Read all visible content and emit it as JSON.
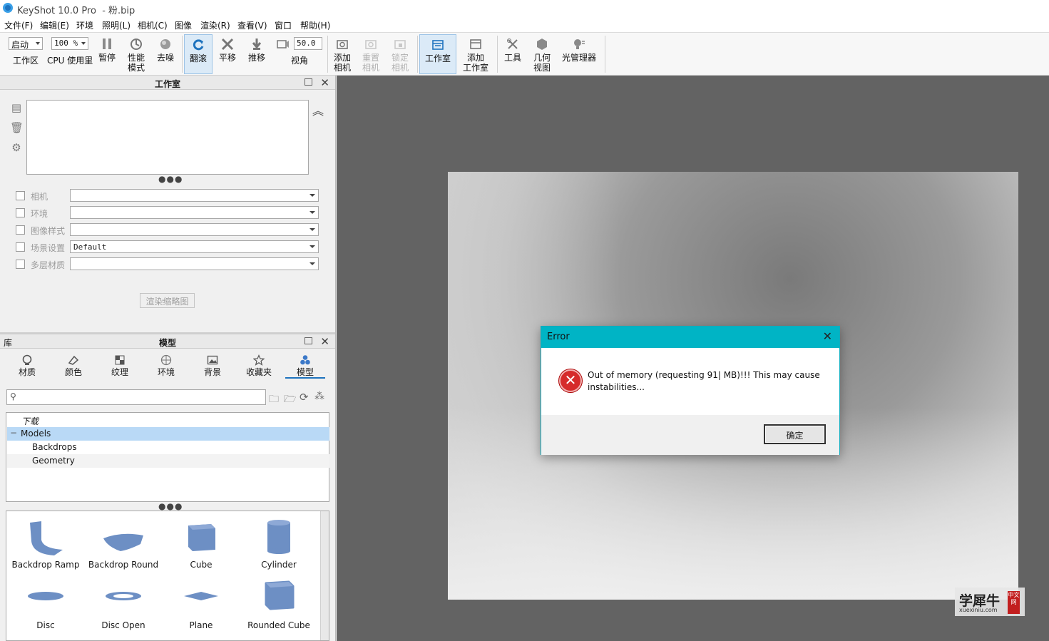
{
  "window": {
    "title": "KeyShot 10.0 Pro  - 粉.bip"
  },
  "menu": [
    "文件(F)",
    "编辑(E)",
    "环境",
    "照明(L)",
    "相机(C)",
    "图像",
    "渲染(R)",
    "查看(V)",
    "窗口",
    "帮助(H)"
  ],
  "toolbar": {
    "workspace_combo": "启动",
    "workspace_label": "工作区",
    "cpu_combo": "100 %",
    "cpu_label": "CPU 使用里",
    "pause": "暂停",
    "perf_mode": "性能\n模式",
    "denoise": "去噪",
    "tumble": "翻滚",
    "pan": "平移",
    "dolly": "推移",
    "fov_value": "50.0",
    "fov_label": "视角",
    "add_camera": "添加\n相机",
    "reset_camera": "重置\n相机",
    "lock_camera": "锁定\n相机",
    "studio": "工作室",
    "add_studio": "添加\n工作室",
    "tools": "工具",
    "geometry_view": "几何\n视图",
    "light_manager": "光管理器"
  },
  "studio_panel": {
    "title": "工作室",
    "options": [
      {
        "label": "相机",
        "value": ""
      },
      {
        "label": "环境",
        "value": ""
      },
      {
        "label": "图像样式",
        "value": ""
      },
      {
        "label": "场景设置",
        "value": "Default"
      },
      {
        "label": "多层材质",
        "value": ""
      }
    ],
    "render_thumbnail_btn": "渲染缩略图"
  },
  "library_panel": {
    "left_label": "库",
    "title": "模型",
    "tabs": [
      "材质",
      "颜色",
      "纹理",
      "环境",
      "背景",
      "收藏夹",
      "模型"
    ],
    "active_tab": "模型",
    "search_placeholder": "",
    "tree": [
      "下载",
      "Models",
      "Backdrops",
      "Geometry"
    ],
    "models": [
      "Backdrop Ramp",
      "Backdrop Round",
      "Cube",
      "Cylinder",
      "Disc",
      "Disc Open",
      "Plane",
      "Rounded Cube"
    ]
  },
  "dialog": {
    "title": "Error",
    "message": "Out of memory (requesting 91| MB)!!! This may cause instabilities...",
    "ok": "确定"
  },
  "watermark": {
    "main": "学犀牛",
    "sub": "xuexiniu.com",
    "badge": "中文网"
  },
  "colors": {
    "dialog_title": "#00b4c5",
    "active_blue": "#1e73be",
    "viewport": "#636363"
  }
}
